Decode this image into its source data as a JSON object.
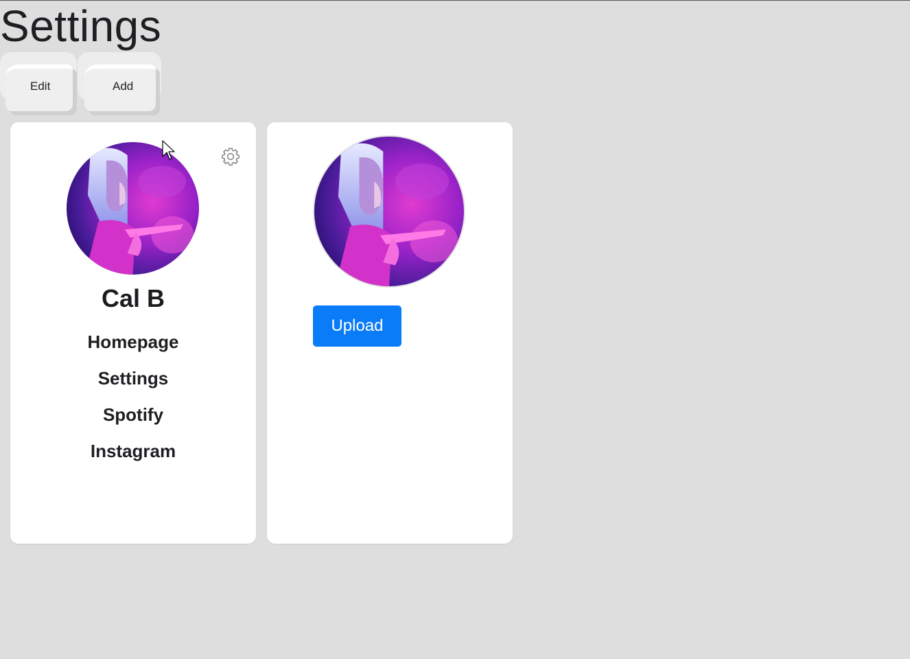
{
  "page": {
    "title": "Settings"
  },
  "toolbar": {
    "edit_label": "Edit",
    "add_label": "Add"
  },
  "profile_card": {
    "name": "Cal B",
    "avatar_icon": "profile-photo",
    "settings_icon": "gear-icon",
    "nav_items": [
      {
        "label": "Homepage"
      },
      {
        "label": "Settings"
      },
      {
        "label": "Spotify"
      },
      {
        "label": "Instagram"
      }
    ]
  },
  "upload_card": {
    "avatar_icon": "profile-photo",
    "upload_label": "Upload"
  },
  "colors": {
    "background": "#dedede",
    "card": "#ffffff",
    "upload_button": "#0a7cf8",
    "text": "#1f1f23"
  }
}
